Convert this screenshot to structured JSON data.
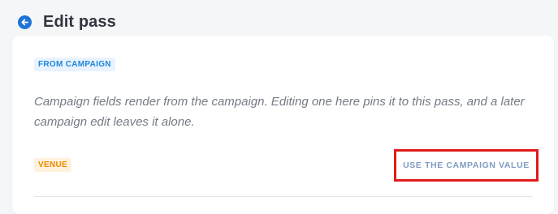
{
  "header": {
    "title": "Edit pass",
    "back_icon": "arrow-left-circle-icon",
    "back_color": "#1d73d8"
  },
  "card": {
    "source_badge": "FROM CAMPAIGN",
    "note": "Campaign fields render from the campaign. Editing one here pins it to this pass, and a later campaign edit leaves it alone.",
    "field_badge": "VENUE",
    "revert_label": "USE THE CAMPAIGN VALUE"
  },
  "colors": {
    "source_badge_text": "#1e86d6",
    "source_badge_bg": "#e9f3ff",
    "field_badge_text": "#ec8a00",
    "field_badge_bg": "#fff1dc",
    "highlight_border": "#e01b1b",
    "link_text": "#7f9bc2"
  }
}
